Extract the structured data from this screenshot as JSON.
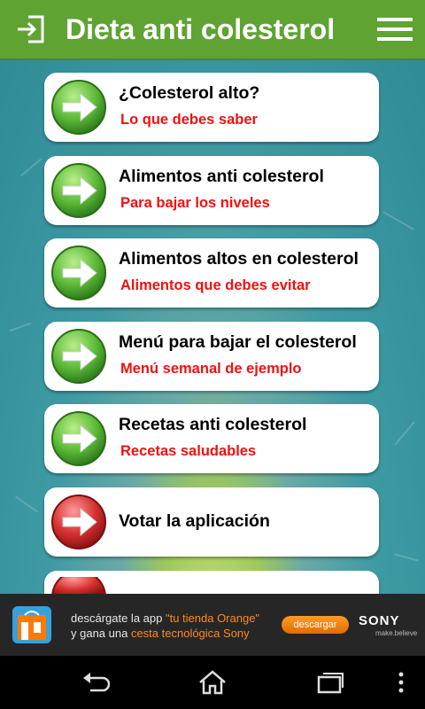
{
  "header": {
    "title": "Dieta anti colesterol",
    "exit_icon": "exit-icon",
    "menu_icon": "hamburger-menu-icon"
  },
  "menu_items": [
    {
      "title": "¿Colesterol alto?",
      "subtitle": "Lo que debes saber",
      "icon": "green-arrow-icon"
    },
    {
      "title": "Alimentos anti colesterol",
      "subtitle": "Para bajar los niveles",
      "icon": "green-arrow-icon"
    },
    {
      "title": "Alimentos altos en colesterol",
      "subtitle": "Alimentos que debes evitar",
      "icon": "green-arrow-icon"
    },
    {
      "title": "Menú para bajar el colesterol",
      "subtitle": "Menú semanal de ejemplo",
      "icon": "green-arrow-icon"
    },
    {
      "title": "Recetas anti colesterol",
      "subtitle": "Recetas saludables",
      "icon": "green-arrow-icon"
    },
    {
      "title": "Votar la aplicación",
      "subtitle": "",
      "icon": "red-arrow-icon"
    }
  ],
  "ad": {
    "line1_prefix": "descárgate la app ",
    "line1_highlight": "\"tu tienda Orange\"",
    "line2_prefix": "y gana una ",
    "line2_highlight": "cesta tecnológica Sony",
    "cta": "descargar",
    "brand": "SONY",
    "tagline": "make.believe"
  },
  "navbar": {
    "back": "back-icon",
    "home": "home-icon",
    "recent": "recent-apps-icon",
    "more": "overflow-menu-icon"
  },
  "colors": {
    "header_green": "#5fa333",
    "subtitle_red": "#e11111",
    "arrow_green": "#4caf34",
    "arrow_red": "#d32424"
  }
}
